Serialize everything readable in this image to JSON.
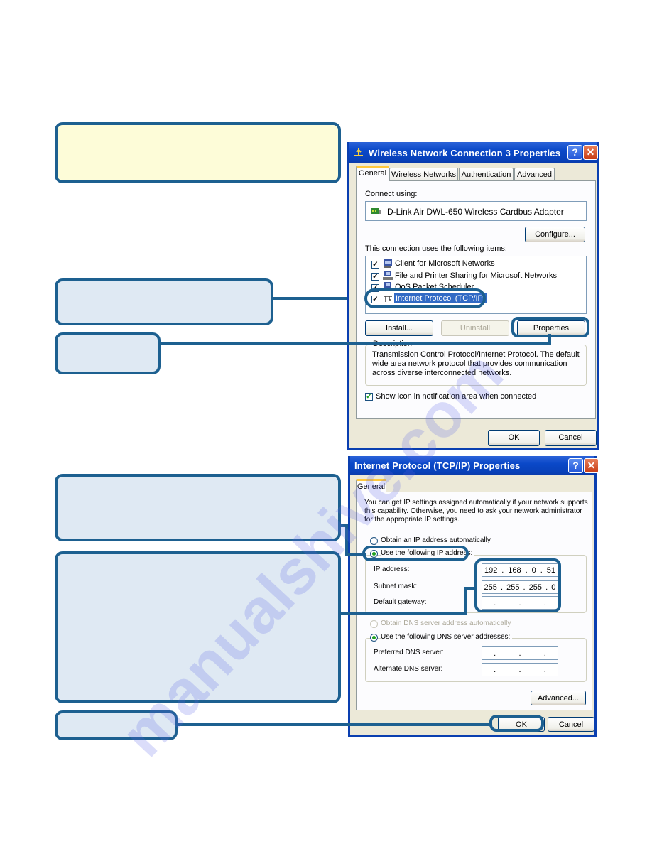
{
  "callouts": [
    {
      "id": "intro",
      "text": ""
    },
    {
      "id": "select-tcpip",
      "text": ""
    },
    {
      "id": "click-properties",
      "text": ""
    },
    {
      "id": "use-following-ip",
      "text": ""
    },
    {
      "id": "enter-ip-settings",
      "text": ""
    },
    {
      "id": "click-ok",
      "text": ""
    }
  ],
  "dialog1": {
    "title": "Wireless Network Connection 3 Properties",
    "help_label": "?",
    "close_label": "✕",
    "tabs": [
      "General",
      "Wireless Networks",
      "Authentication",
      "Advanced"
    ],
    "active_tab": "General",
    "connect_using_label": "Connect using:",
    "adapter_name": "D-Link Air DWL-650 Wireless Cardbus Adapter",
    "configure_label": "Configure...",
    "items_label": "This connection uses the following items:",
    "items": [
      {
        "label": "Client for Microsoft Networks",
        "checked": true,
        "icon": "network-client-icon"
      },
      {
        "label": "File and Printer Sharing for Microsoft Networks",
        "checked": true,
        "icon": "file-sharing-icon"
      },
      {
        "label": "QoS Packet Scheduler",
        "checked": true,
        "icon": "scheduler-icon"
      },
      {
        "label": "Internet Protocol (TCP/IP)",
        "checked": true,
        "icon": "protocol-icon",
        "selected": true
      }
    ],
    "install_label": "Install...",
    "uninstall_label": "Uninstall",
    "properties_label": "Properties",
    "description_label": "Description",
    "description_text": "Transmission Control Protocol/Internet Protocol. The default wide area network protocol that provides communication across diverse interconnected networks.",
    "show_icon_label": "Show icon in notification area when connected",
    "show_icon_checked": true,
    "ok_label": "OK",
    "cancel_label": "Cancel"
  },
  "dialog2": {
    "title": "Internet Protocol (TCP/IP) Properties",
    "help_label": "?",
    "close_label": "✕",
    "tabs": [
      "General"
    ],
    "intro_text": "You can get IP settings assigned automatically if your network supports this capability. Otherwise, you need to ask your network administrator for the appropriate IP settings.",
    "radio_auto_ip": "Obtain an IP address automatically",
    "radio_manual_ip": "Use the following IP address:",
    "ip_mode": "manual",
    "ip_address_label": "IP address:",
    "ip_address": [
      "192",
      "168",
      "0",
      "51"
    ],
    "subnet_mask_label": "Subnet mask:",
    "subnet_mask": [
      "255",
      "255",
      "255",
      "0"
    ],
    "gateway_label": "Default gateway:",
    "gateway": [
      "",
      "",
      "",
      ""
    ],
    "radio_auto_dns": "Obtain DNS server address automatically",
    "radio_manual_dns": "Use the following DNS server addresses:",
    "dns_mode": "manual",
    "preferred_dns_label": "Preferred DNS server:",
    "preferred_dns": [
      "",
      "",
      "",
      ""
    ],
    "alternate_dns_label": "Alternate DNS server:",
    "alternate_dns": [
      "",
      "",
      "",
      ""
    ],
    "advanced_label": "Advanced...",
    "ok_label": "OK",
    "cancel_label": "Cancel"
  },
  "watermark": "manualshive.com",
  "colors": {
    "callout_border": "#1d6090",
    "callout_fill": "#dfe9f3",
    "callout_fill_intro": "#fdfcd8",
    "titlebar": "#0a48c8",
    "selection": "#316ac5"
  }
}
